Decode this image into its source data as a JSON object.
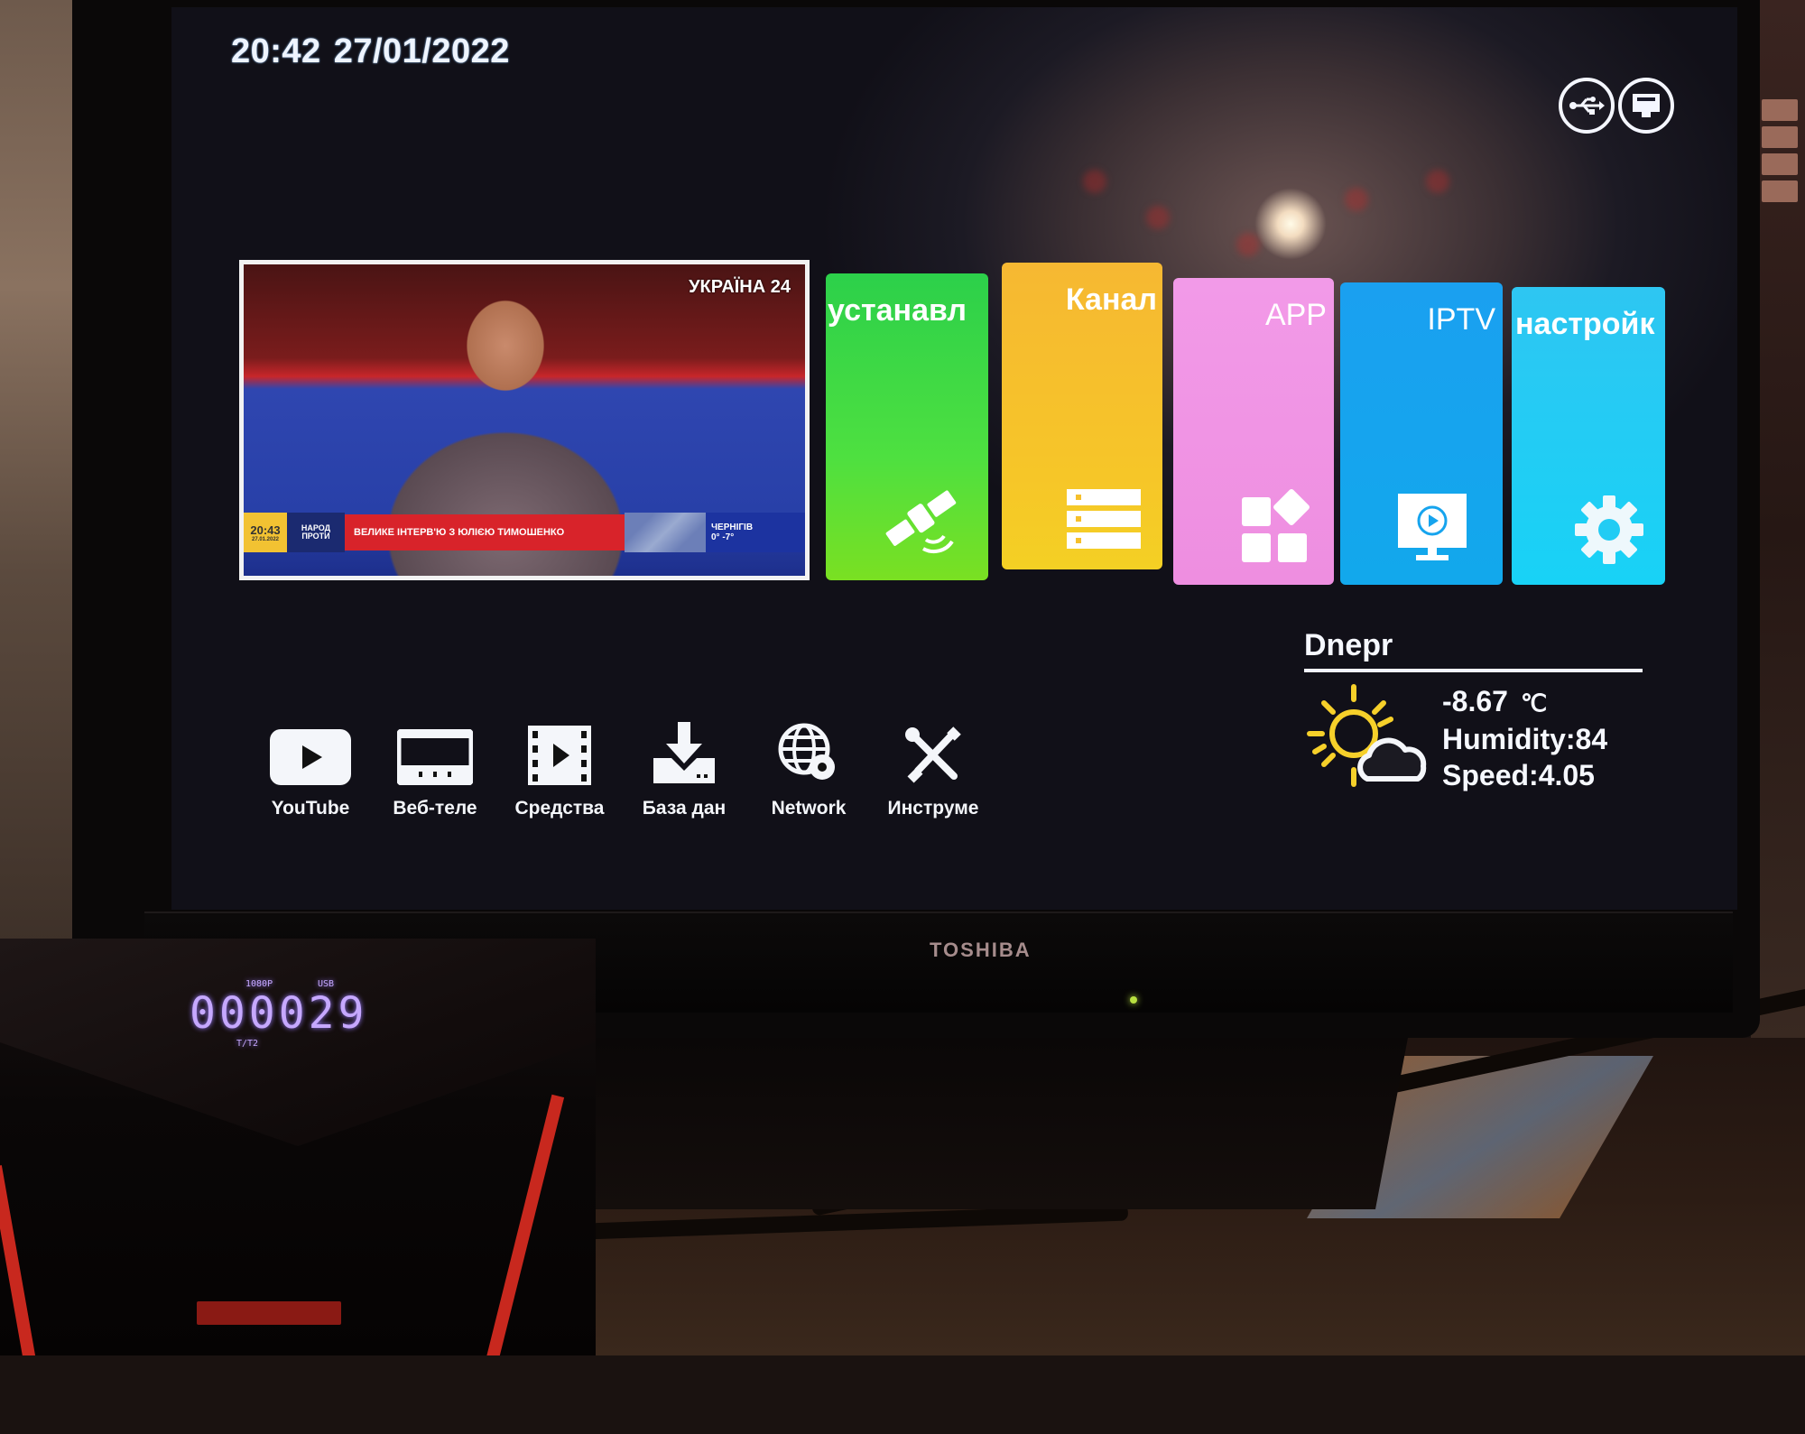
{
  "screen": {
    "clock": {
      "time": "20:42",
      "date": "27/01/2022"
    },
    "status_icons": [
      {
        "name": "usb-icon",
        "label": "USB"
      },
      {
        "name": "ethernet-icon",
        "label": "LAN"
      }
    ],
    "preview": {
      "channel_logo": "УКРАЇНА 24",
      "lower_third": {
        "time": "20:43",
        "date": "27.01.2022",
        "show": "НАРОД ПРОТИ",
        "headline": "ВЕЛИКЕ ІНТЕРВ'Ю З ЮЛІЄЮ ТИМОШЕНКО",
        "weather_city": "ЧЕРНІГІВ",
        "weather_temp": "0° -7°"
      }
    },
    "tiles": [
      {
        "id": "install",
        "label": "устанавл",
        "icon": "satellite-icon",
        "color": "#3cd840"
      },
      {
        "id": "channel",
        "label": "Канал",
        "icon": "list-icon",
        "color": "#f6c02c"
      },
      {
        "id": "app",
        "label": "APP",
        "icon": "apps-grid-icon",
        "color": "#f094e4"
      },
      {
        "id": "iptv",
        "label": "IPTV",
        "icon": "monitor-play-icon",
        "color": "#16a4ee"
      },
      {
        "id": "settings",
        "label": "настройк",
        "icon": "gear-icon",
        "color": "#22ccf4"
      }
    ],
    "apps": [
      {
        "label": "YouTube",
        "icon": "youtube-play-icon"
      },
      {
        "label": "Веб-теле",
        "icon": "web-tv-icon"
      },
      {
        "label": "Средства",
        "icon": "film-play-icon"
      },
      {
        "label": "База дан",
        "icon": "download-icon"
      },
      {
        "label": "Network",
        "icon": "globe-gear-icon"
      },
      {
        "label": "Инструме",
        "icon": "tools-icon"
      }
    ],
    "weather": {
      "city": "Dnepr",
      "temperature": "-8.67",
      "unit": "℃",
      "humidity": "Humidity:84",
      "speed": "Speed:4.05",
      "icon": "partly-cloudy-icon"
    }
  },
  "tv": {
    "brand": "TOSHIBA"
  },
  "set_top_box": {
    "display": "000029",
    "tag_resolution": "1080P",
    "tag_usb": "USB",
    "tag_mode": "T/T2"
  }
}
